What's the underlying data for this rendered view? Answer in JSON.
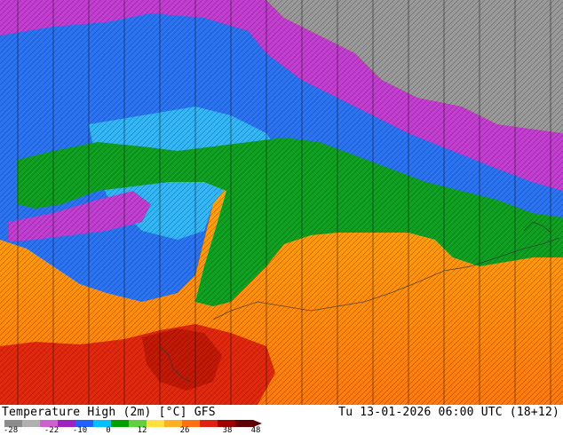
{
  "map": {
    "description_colors": {
      "ocean_cold": "#1a6cff",
      "green_zone": "#10a020",
      "warm_yellow": "#ffd020",
      "warm_orange": "#ff9a10",
      "hot_red": "#e02010",
      "purple_zone": "#c040d0",
      "gray_zone": "#808080",
      "label_text": "#000000"
    }
  },
  "footer": {
    "title": "Temperature High (2m) [°C] GFS",
    "valid_time": "Tu 13-01-2026 06:00 UTC (18+12)"
  },
  "colorbar": {
    "ticks": [
      "-28",
      "-22",
      "-10",
      "0",
      "12",
      "26",
      "38",
      "48"
    ],
    "colors": [
      "#8c8c8c",
      "#b0b0b0",
      "#d060d0",
      "#a020c0",
      "#2060ff",
      "#00c0ff",
      "#00a000",
      "#60d040",
      "#ffe040",
      "#ffb020",
      "#ff7010",
      "#e02010",
      "#a00000",
      "#600000"
    ]
  }
}
